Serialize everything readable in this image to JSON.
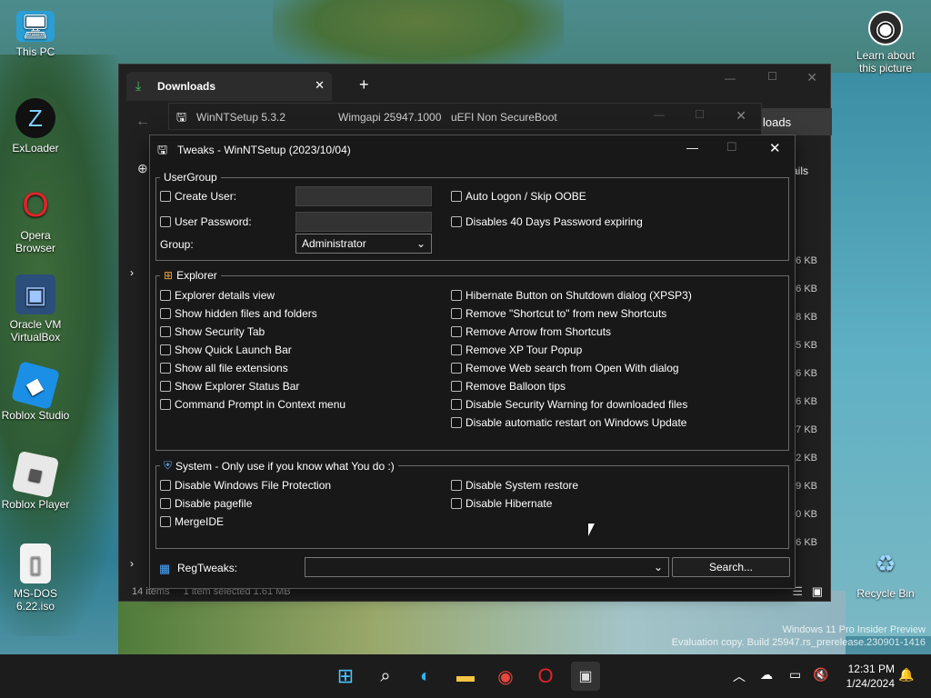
{
  "desktop": {
    "icons": [
      {
        "label": "This PC",
        "icon": "monitor-icon"
      },
      {
        "label": "ExLoader",
        "icon": "exloader-icon"
      },
      {
        "label": "Opera Browser",
        "icon": "opera-icon"
      },
      {
        "label": "Oracle VM VirtualBox",
        "icon": "virtualbox-icon"
      },
      {
        "label": "Roblox Studio",
        "icon": "roblox-studio-icon"
      },
      {
        "label": "Roblox Player",
        "icon": "roblox-player-icon"
      },
      {
        "label": "MS-DOS 6.22.iso",
        "icon": "file-icon"
      },
      {
        "label": "Learn about this picture",
        "icon": "camera-icon"
      },
      {
        "label": "Recycle Bin",
        "icon": "recycle-bin-icon"
      }
    ],
    "watermark_line1": "Windows 11 Pro Insider Preview",
    "watermark_line2": "Evaluation copy. Build 25947.rs_prerelease.230901-1416"
  },
  "downloads_window": {
    "tab_title": "Downloads",
    "new_tab": "+",
    "header_partial": "loads",
    "details_partial": "ails",
    "sizes": [
      "6 KB",
      "6 KB",
      "8 KB",
      "5 KB",
      "6 KB",
      "6 KB",
      "7 KB",
      "2 KB",
      "9 KB",
      "0 KB",
      "6 KB"
    ],
    "status_items": "14 items",
    "status_selected": "1 item selected  1.61 MB"
  },
  "winntsetup_window": {
    "title": "WinNTSetup 5.3.2",
    "wimgapi": "Wimgapi 25947.1000",
    "uefi": "uEFI Non SecureBoot"
  },
  "tweaks": {
    "title": "Tweaks - WinNTSetup (2023/10/04)",
    "usergroup": {
      "title": "UserGroup",
      "create_user": "Create User:",
      "user_password": "User Password:",
      "group_label": "Group:",
      "group_value": "Administrator",
      "auto_logon": "Auto Logon / Skip OOBE",
      "disable_40days": "Disables 40 Days Password expiring"
    },
    "explorer": {
      "title": "Explorer",
      "left": [
        "Explorer details view",
        "Show hidden files and folders",
        "Show Security Tab",
        "Show Quick Launch Bar",
        "Show all file extensions",
        "Show Explorer Status Bar",
        "Command Prompt in Context menu"
      ],
      "right": [
        "Hibernate Button on Shutdown dialog (XPSP3)",
        "Remove \"Shortcut to\" from new Shortcuts",
        "Remove Arrow from Shortcuts",
        "Remove XP Tour Popup",
        "Remove Web search from Open With dialog",
        "Remove Balloon tips",
        "Disable Security Warning for downloaded files",
        "Disable automatic restart on Windows Update"
      ]
    },
    "system": {
      "title": "System - Only use if you know what You do :)",
      "left": [
        "Disable Windows File Protection",
        "Disable pagefile",
        "MergeIDE"
      ],
      "right": [
        "Disable System restore",
        "Disable Hibernate"
      ]
    },
    "regtweaks_label": "RegTweaks:",
    "search_button": "Search..."
  },
  "taskbar": {
    "time": "12:31 PM",
    "date": "1/24/2024"
  }
}
